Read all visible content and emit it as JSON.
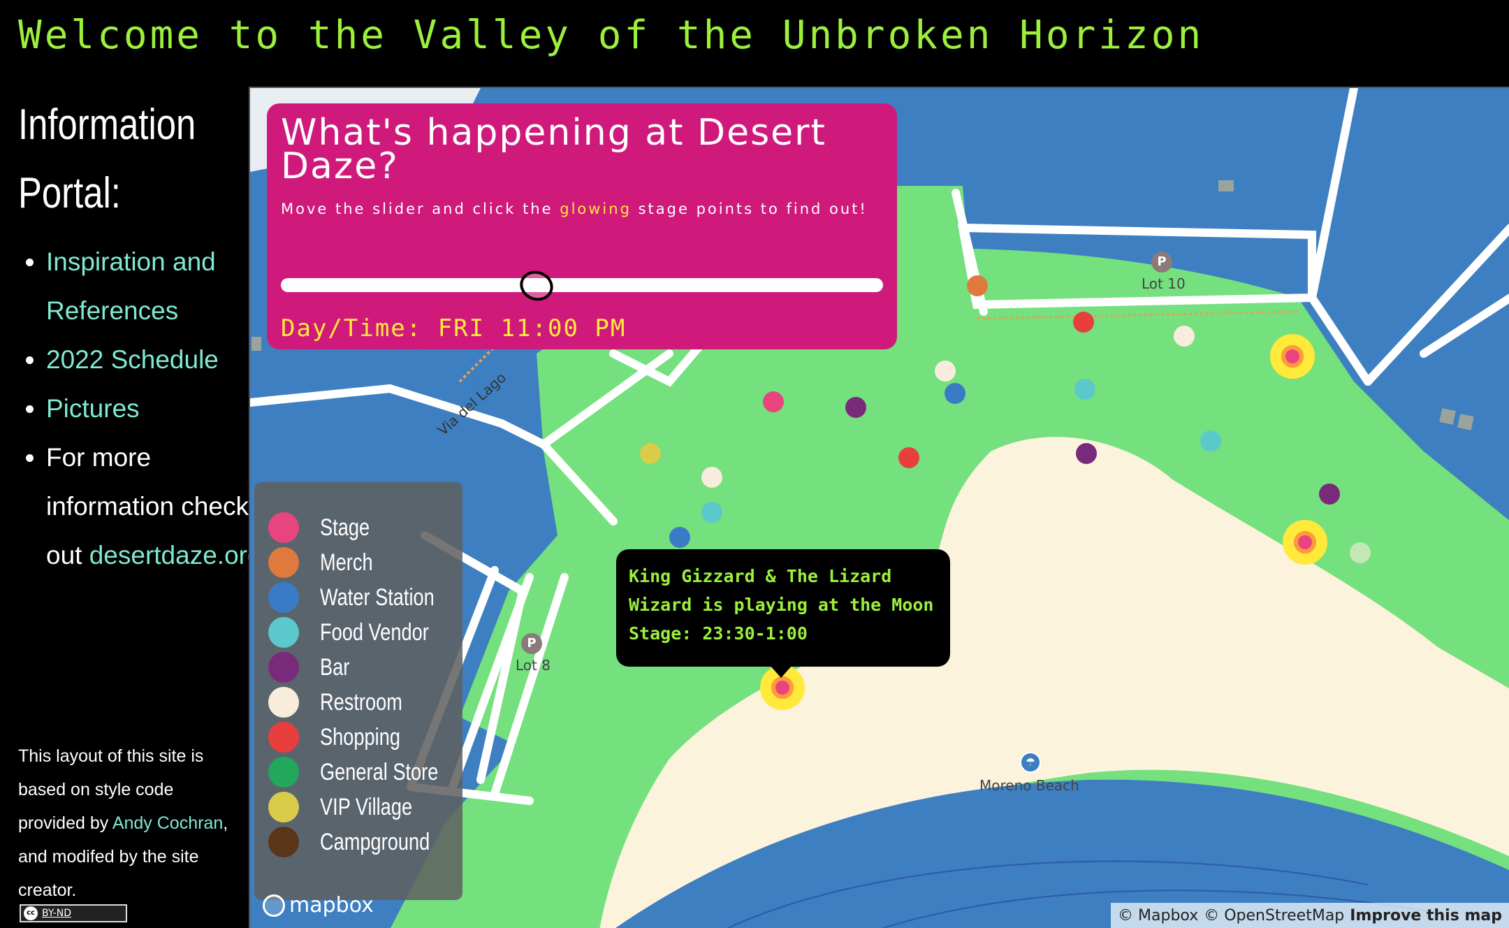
{
  "site": {
    "title": "Welcome to the Valley of the Unbroken Horizon"
  },
  "sidebar": {
    "portal_title": "Information Portal:",
    "nav": {
      "inspiration": "Inspiration and References",
      "schedule": "2022 Schedule",
      "pictures": "Pictures",
      "more_info_prefix": "For more information check out",
      "more_info_link": "desertdaze.org",
      "more_info_suffix": "."
    },
    "credit": {
      "prefix": "This layout of this site is based on style code provided by",
      "author_link": "Andy Cochran",
      "suffix": ", and modifed by the site creator."
    },
    "license_badge": {
      "cc": "cc",
      "label": "BY-ND"
    }
  },
  "panel": {
    "title": "What's happening at Desert Daze?",
    "instruction_before": "Move the slider and click the",
    "instruction_highlight": "glowing",
    "instruction_after": "stage points to find out!",
    "slider_fraction": 0.42,
    "day_time": "Day/Time: FRI 11:00 PM"
  },
  "legend": [
    {
      "label": "Stage",
      "color": "#e8457f"
    },
    {
      "label": "Merch",
      "color": "#e07a3c"
    },
    {
      "label": "Water Station",
      "color": "#3a7bc8"
    },
    {
      "label": "Food Vendor",
      "color": "#5bc8cc"
    },
    {
      "label": "Bar",
      "color": "#7a2a7a"
    },
    {
      "label": "Restroom",
      "color": "#f8ecdc"
    },
    {
      "label": "Shopping",
      "color": "#e83e3e"
    },
    {
      "label": "General Store",
      "color": "#22a85a"
    },
    {
      "label": "VIP Village",
      "color": "#d8cc48"
    },
    {
      "label": "Campground",
      "color": "#5a3518"
    }
  ],
  "popup": {
    "text": "King Gizzard & The Lizard Wizard is playing at the Moon Stage: 23:30-1:00"
  },
  "map": {
    "labels": {
      "road": "Via del Lago",
      "lot10": "Lot 10",
      "lot8": "Lot 8",
      "beach": "Moreno Beach",
      "parking_symbol": "P"
    },
    "logo": "mapbox",
    "attribution": {
      "mapbox": "© Mapbox",
      "osm": "© OpenStreetMap",
      "improve": "Improve this map"
    }
  }
}
